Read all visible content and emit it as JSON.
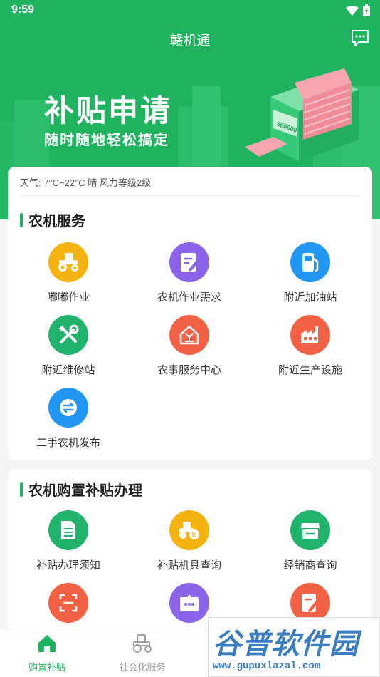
{
  "status": {
    "time": "9:59"
  },
  "app": {
    "title": "赣机通"
  },
  "banner": {
    "title": "补贴申请",
    "subtitle": "随时随地轻松搞定",
    "machine_text": "500000"
  },
  "weather": {
    "text": "天气: 7°C~22°C 晴 风力等级2级"
  },
  "sections": [
    {
      "title": "农机服务",
      "items": [
        {
          "label": "嘟嘟作业",
          "icon": "tractor-icon",
          "color": "#f5b311"
        },
        {
          "label": "农机作业需求",
          "icon": "edit-document-icon",
          "color": "#8a63e8"
        },
        {
          "label": "附近加油站",
          "icon": "gas-station-icon",
          "color": "#2196f3"
        },
        {
          "label": "附近维修站",
          "icon": "repair-tools-icon",
          "color": "#21b36b"
        },
        {
          "label": "农事服务中心",
          "icon": "farm-house-icon",
          "color": "#f26143"
        },
        {
          "label": "附近生产设施",
          "icon": "factory-icon",
          "color": "#f26143"
        },
        {
          "label": "二手农机发布",
          "icon": "exchange-icon",
          "color": "#2196f3"
        }
      ]
    },
    {
      "title": "农机购置补贴办理",
      "items": [
        {
          "label": "补贴办理须知",
          "icon": "document-icon",
          "color": "#21b36b"
        },
        {
          "label": "补贴机具查询",
          "icon": "tractor-search-icon",
          "color": "#f5b311"
        },
        {
          "label": "经销商查询",
          "icon": "store-icon",
          "color": "#21b36b"
        },
        {
          "label": "",
          "icon": "scan-icon",
          "color": "#f26143"
        },
        {
          "label": "",
          "icon": "chat-box-icon",
          "color": "#8a63e8"
        },
        {
          "label": "",
          "icon": "edit-note-icon",
          "color": "#f26143"
        }
      ]
    }
  ],
  "tabs": [
    {
      "label": "购置补贴",
      "icon": "home-icon",
      "active": true
    },
    {
      "label": "社会化服务",
      "icon": "tractor-outline-icon",
      "active": false
    }
  ],
  "colors": {
    "primary": "#1fb35f",
    "tab_active": "#1fb35f",
    "tab_inactive": "#999999"
  },
  "watermark": {
    "text": "谷普软件园",
    "url": "www.gupuxlazal.com"
  }
}
